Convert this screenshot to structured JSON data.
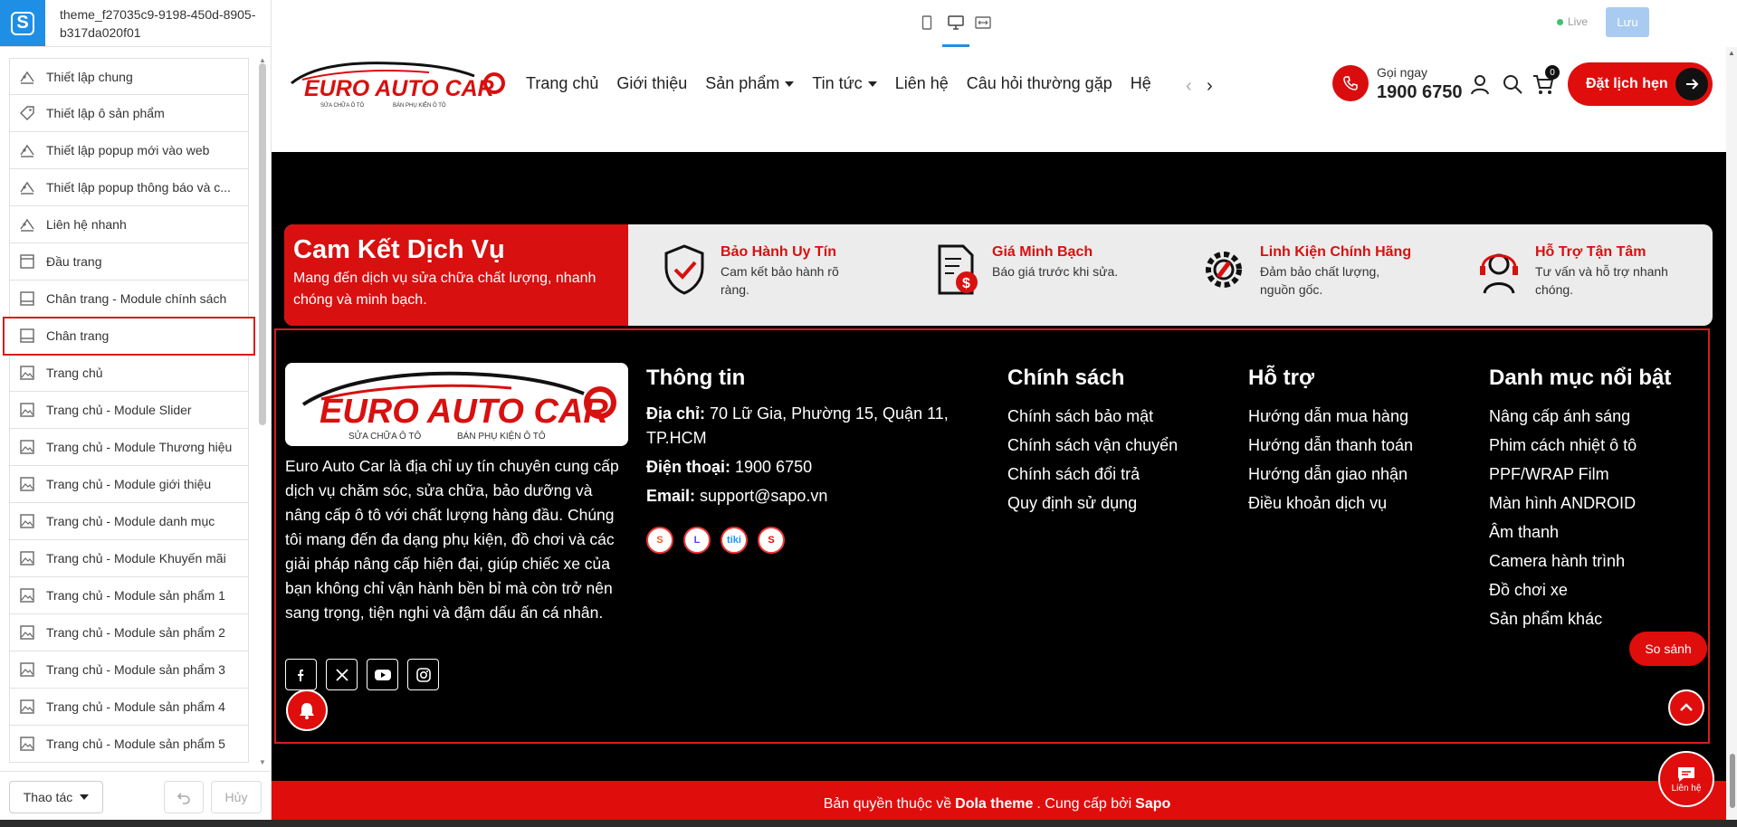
{
  "app": {
    "logo_letter": "S",
    "theme_name": "theme_f27035c9-9198-450d-8905-b317da020f01"
  },
  "toolbar": {
    "live_label": "Live",
    "save_label": "Lưu",
    "devices": [
      "mobile-icon",
      "desktop-icon",
      "fullwidth-icon"
    ],
    "active_device": "desktop-icon"
  },
  "sidebar": {
    "items": [
      {
        "label": "Thiết lập chung",
        "icon": "sliders-icon"
      },
      {
        "label": "Thiết lập ô sản phẩm",
        "icon": "tag-icon"
      },
      {
        "label": "Thiết lập popup mới vào web",
        "icon": "sliders-icon"
      },
      {
        "label": "Thiết lập popup thông báo và c...",
        "icon": "sliders-icon"
      },
      {
        "label": "Liên hệ nhanh",
        "icon": "sliders-icon"
      },
      {
        "label": "Đầu trang",
        "icon": "header-icon"
      },
      {
        "label": "Chân trang - Module chính sách",
        "icon": "footer-icon"
      },
      {
        "label": "Chân trang",
        "icon": "footer-icon",
        "active": true
      },
      {
        "label": "Trang chủ",
        "icon": "image-icon"
      },
      {
        "label": "Trang chủ - Module Slider",
        "icon": "image-icon"
      },
      {
        "label": "Trang chủ - Module Thương hiệu",
        "icon": "image-icon"
      },
      {
        "label": "Trang chủ - Module giới thiệu",
        "icon": "image-icon"
      },
      {
        "label": "Trang chủ - Module danh mục",
        "icon": "image-icon"
      },
      {
        "label": "Trang chủ - Module Khuyến mãi",
        "icon": "image-icon"
      },
      {
        "label": "Trang chủ - Module sản phẩm 1",
        "icon": "image-icon"
      },
      {
        "label": "Trang chủ - Module sản phẩm 2",
        "icon": "image-icon"
      },
      {
        "label": "Trang chủ - Module sản phẩm 3",
        "icon": "image-icon"
      },
      {
        "label": "Trang chủ - Module sản phẩm 4",
        "icon": "image-icon"
      },
      {
        "label": "Trang chủ - Module sản phẩm 5",
        "icon": "image-icon"
      }
    ],
    "actions_label": "Thao tác",
    "cancel_label": "Hủy"
  },
  "site": {
    "logo_text": "EURO AUTO CAR",
    "logo_tagline_left": "SỬA CHỮA Ô TÔ",
    "logo_tagline_right": "BÁN PHỤ KIỆN Ô TÔ",
    "nav": [
      {
        "label": "Trang chủ",
        "dropdown": false
      },
      {
        "label": "Giới thiệu",
        "dropdown": false
      },
      {
        "label": "Sản phẩm",
        "dropdown": true
      },
      {
        "label": "Tin tức",
        "dropdown": true
      },
      {
        "label": "Liên hệ",
        "dropdown": false
      },
      {
        "label": "Câu hỏi thường gặp",
        "dropdown": false
      },
      {
        "label": "Hệ",
        "dropdown": false
      }
    ],
    "phone_label": "Gọi ngay",
    "phone_number": "1900 6750",
    "cart_count": "0",
    "book_label": "Đặt lịch hẹn"
  },
  "service": {
    "title": "Cam Kết Dịch Vụ",
    "subtitle": "Mang đến dịch vụ sửa chữa chất lượng, nhanh chóng và minh bạch.",
    "items": [
      {
        "title": "Bảo Hành Uy Tín",
        "text": "Cam kết bảo hành rõ ràng.",
        "icon": "shield-check-icon"
      },
      {
        "title": "Giá Minh Bạch",
        "text": "Báo giá trước khi sửa.",
        "icon": "invoice-dollar-icon"
      },
      {
        "title": "Linh Kiện Chính Hãng",
        "text": "Đảm bảo chất lượng, nguồn gốc.",
        "icon": "gear-wrench-icon"
      },
      {
        "title": "Hỗ Trợ Tận Tâm",
        "text": "Tư vấn và hỗ trợ nhanh chóng.",
        "icon": "headset-icon"
      }
    ]
  },
  "footer": {
    "about": "Euro Auto Car là địa chỉ uy tín chuyên cung cấp dịch vụ chăm sóc, sửa chữa, bảo dưỡng và nâng cấp ô tô với chất lượng hàng đầu. Chúng tôi mang đến đa dạng phụ kiện, đồ chơi và các giải pháp nâng cấp hiện đại, giúp chiếc xe của bạn không chỉ vận hành bền bỉ mà còn trở nên sang trọng, tiện nghi và đậm dấu ấn cá nhân.",
    "social": [
      "facebook-icon",
      "x-icon",
      "youtube-icon",
      "instagram-icon"
    ],
    "info": {
      "title": "Thông tin",
      "address_label": "Địa chỉ:",
      "address": "70 Lữ Gia, Phường 15, Quận 11, TP.HCM",
      "phone_label": "Điện thoại:",
      "phone": "1900 6750",
      "email_label": "Email:",
      "email": "support@sapo.vn",
      "shops": [
        {
          "icon": "shopee-icon",
          "glyph": "S"
        },
        {
          "icon": "lazada-icon",
          "glyph": "L"
        },
        {
          "icon": "tiki-icon",
          "glyph": "tiki"
        },
        {
          "icon": "sendo-icon",
          "glyph": "S"
        }
      ]
    },
    "policy": {
      "title": "Chính sách",
      "links": [
        "Chính sách bảo mật",
        "Chính sách vận chuyển",
        "Chính sách đổi trả",
        "Quy định sử dụng"
      ]
    },
    "support": {
      "title": "Hỗ trợ",
      "links": [
        "Hướng dẫn mua hàng",
        "Hướng dẫn thanh toán",
        "Hướng dẫn giao nhận",
        "Điều khoản dịch vụ"
      ]
    },
    "categories": {
      "title": "Danh mục nổi bật",
      "links": [
        "Nâng cấp ánh sáng",
        "Phim cách nhiệt ô tô",
        "PPF/WRAP Film",
        "Màn hình ANDROID",
        "Âm thanh",
        "Camera hành trình",
        "Đồ chơi xe",
        "Sản phẩm khác"
      ]
    },
    "compare_label": "So sánh",
    "contact_label": "Liên hệ",
    "copyright_prefix": "Bản quyền thuộc về",
    "copyright_brand": "Dola theme",
    "copyright_mid": ". Cung cấp bởi",
    "copyright_provider": "Sapo"
  },
  "colors": {
    "accent": "#1f8fe5",
    "brand_red": "#e00d0d",
    "footer_bg": "#000000",
    "selection": "#d91c1c"
  }
}
